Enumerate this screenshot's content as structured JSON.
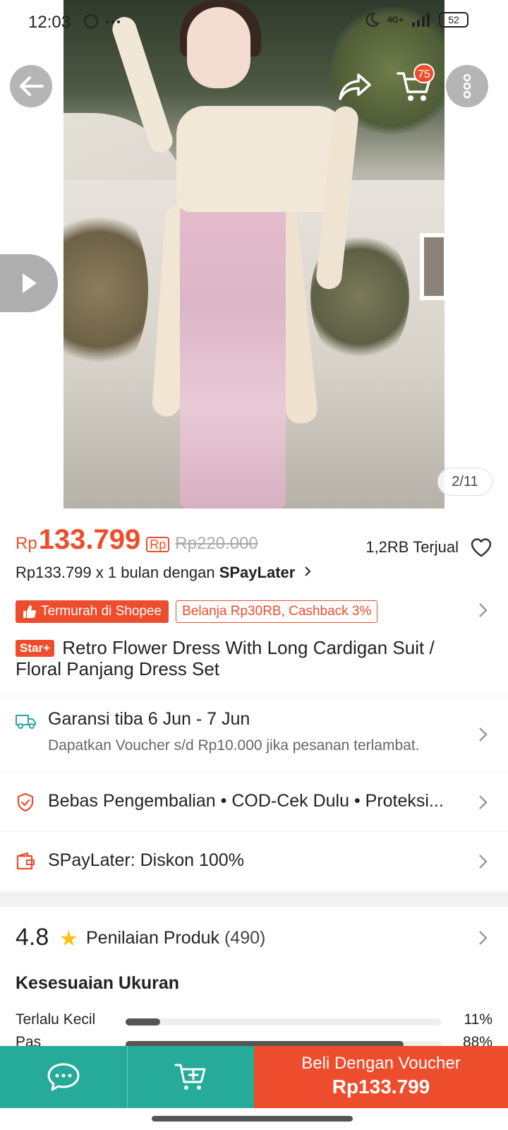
{
  "status_bar": {
    "time": "12:03",
    "network": "4G+",
    "battery": "52"
  },
  "gallery": {
    "counter": "2/11",
    "cart_count": "75"
  },
  "product": {
    "currency": "Rp",
    "price": "133.799",
    "original_price": "Rp220.000",
    "installment_icon_label": "Rp",
    "sold": "1,2RB Terjual",
    "paylater_text": "Rp133.799 x 1 bulan dengan",
    "paylater_brand": "SPayLater",
    "badge_cheapest": "Termurah di Shopee",
    "badge_cashback": "Belanja Rp30RB, Cashback 3%",
    "star_tag": "Star+",
    "title": "Retro Flower Dress With Long Cardigan Suit / Floral Panjang Dress Set"
  },
  "info_rows": {
    "shipping_title": "Garansi tiba 6 Jun - 7 Jun",
    "shipping_sub": "Dapatkan Voucher s/d Rp10.000 jika pesanan terlambat.",
    "guarantee": "Bebas Pengembalian  •  COD-Cek Dulu  •  Proteksi...",
    "paylater_discount": "SPayLater: Diskon 100%"
  },
  "rating": {
    "score": "4.8",
    "label": "Penilaian Produk",
    "count": "(490)"
  },
  "size_fit": {
    "title": "Kesesuaian Ukuran",
    "rows": [
      {
        "label": "Terlalu Kecil",
        "percent": "11%",
        "fraction": 0.11
      },
      {
        "label": "Pas",
        "percent": "88%",
        "fraction": 0.88
      }
    ]
  },
  "bottom_bar": {
    "buy_label": "Beli Dengan Voucher",
    "buy_price": "Rp133.799"
  },
  "colors": {
    "accent": "#ee4d2d",
    "teal": "#26aa99",
    "star": "#ffc107"
  },
  "icons": [
    "back-arrow-icon",
    "share-icon",
    "cart-icon",
    "more-icon",
    "play-icon",
    "heart-icon",
    "truck-icon",
    "shield-icon",
    "wallet-icon",
    "star-icon",
    "chat-icon",
    "add-to-cart-icon",
    "chevron-right-icon"
  ]
}
